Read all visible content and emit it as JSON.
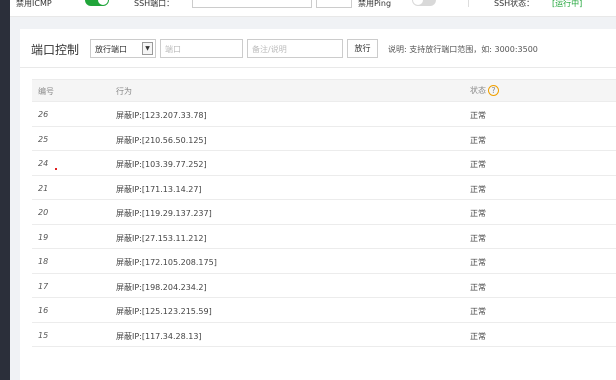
{
  "topbar": {
    "label_a": "禁用ICMP",
    "label_b": "SSH端口：",
    "label_c": "禁用Ping",
    "label_d": "SSH状态：",
    "status_value": "[运行中]"
  },
  "panel": {
    "title": "端口控制",
    "select_value": "放行端口",
    "port_placeholder": "端口",
    "note_placeholder": "备注/说明",
    "submit_label": "放行",
    "hint": "说明: 支持放行端口范围，如: 3000:3500"
  },
  "table": {
    "headers": {
      "id": "编号",
      "action": "行为",
      "status": "状态"
    },
    "rows": [
      {
        "id": "26",
        "action": "屏蔽IP:[123.207.33.78]",
        "status": "正常"
      },
      {
        "id": "25",
        "action": "屏蔽IP:[210.56.50.125]",
        "status": "正常"
      },
      {
        "id": "24",
        "action": "屏蔽IP:[103.39.77.252]",
        "status": "正常"
      },
      {
        "id": "21",
        "action": "屏蔽IP:[171.13.14.27]",
        "status": "正常"
      },
      {
        "id": "20",
        "action": "屏蔽IP:[119.29.137.237]",
        "status": "正常"
      },
      {
        "id": "19",
        "action": "屏蔽IP:[27.153.11.212]",
        "status": "正常"
      },
      {
        "id": "18",
        "action": "屏蔽IP:[172.105.208.175]",
        "status": "正常"
      },
      {
        "id": "17",
        "action": "屏蔽IP:[198.204.234.2]",
        "status": "正常"
      },
      {
        "id": "16",
        "action": "屏蔽IP:[125.123.215.59]",
        "status": "正常"
      },
      {
        "id": "15",
        "action": "屏蔽IP:[117.34.28.13]",
        "status": "正常"
      }
    ]
  },
  "colors": {
    "accent": "#20a53a",
    "help": "#f0a000",
    "sidebar": "#2b2f3a"
  },
  "icons": {
    "help": "help-icon",
    "caret": "chevron-down-icon"
  }
}
